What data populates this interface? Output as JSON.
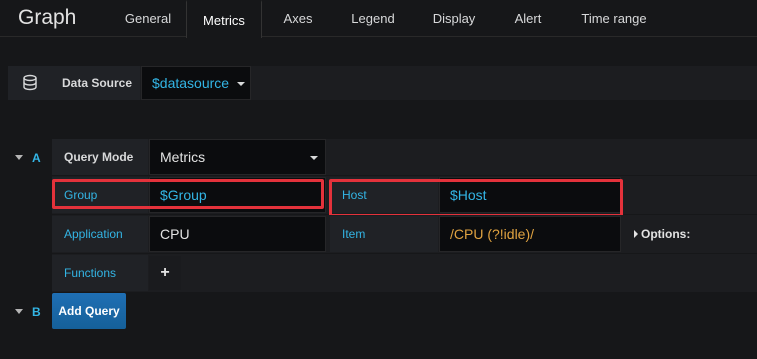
{
  "panel": {
    "title": "Graph"
  },
  "tabs": [
    {
      "label": "General"
    },
    {
      "label": "Metrics"
    },
    {
      "label": "Axes"
    },
    {
      "label": "Legend"
    },
    {
      "label": "Display"
    },
    {
      "label": "Alert"
    },
    {
      "label": "Time range"
    }
  ],
  "active_tab": "Metrics",
  "datasource": {
    "label": "Data Source",
    "value": "$datasource"
  },
  "query_a": {
    "letter": "A",
    "query_mode": {
      "label": "Query Mode",
      "value": "Metrics"
    },
    "group": {
      "label": "Group",
      "value": "$Group"
    },
    "host": {
      "label": "Host",
      "value": "$Host"
    },
    "application": {
      "label": "Application",
      "value": "CPU"
    },
    "item": {
      "label": "Item",
      "value": "/CPU (?!idle)/"
    },
    "options": {
      "label": "Options:"
    },
    "functions": {
      "label": "Functions",
      "add": "+"
    }
  },
  "query_b": {
    "letter": "B",
    "add_query_label": "Add Query"
  },
  "colors": {
    "accent_blue": "#33b5e5",
    "regex_orange": "#e0a341",
    "highlight_red": "#e4323b",
    "button_blue": "#1f78c1"
  }
}
